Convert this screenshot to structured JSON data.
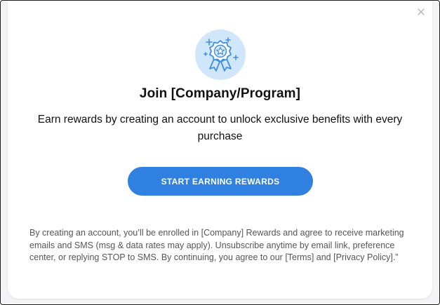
{
  "modal": {
    "title": "Join [Company/Program]",
    "subtitle": "Earn rewards by creating an account to unlock exclusive benefits with every purchase",
    "cta_label": "START EARNING REWARDS",
    "legal_text": "By creating an account, you’ll be enrolled in [Company] Rewards and agree to receive marketing emails and SMS (msg & data rates may apply). Unsubscribe anytime by email link, preference center, or replying STOP to SMS. By continuing, you agree to our [Terms] and [Privacy Policy].”",
    "icons": {
      "close": "close-icon",
      "badge": "award-badge-icon"
    }
  },
  "colors": {
    "accent": "#2f80e0",
    "badge_bg": "#cfe6fb",
    "text": "#111111",
    "muted_text": "#555555"
  }
}
